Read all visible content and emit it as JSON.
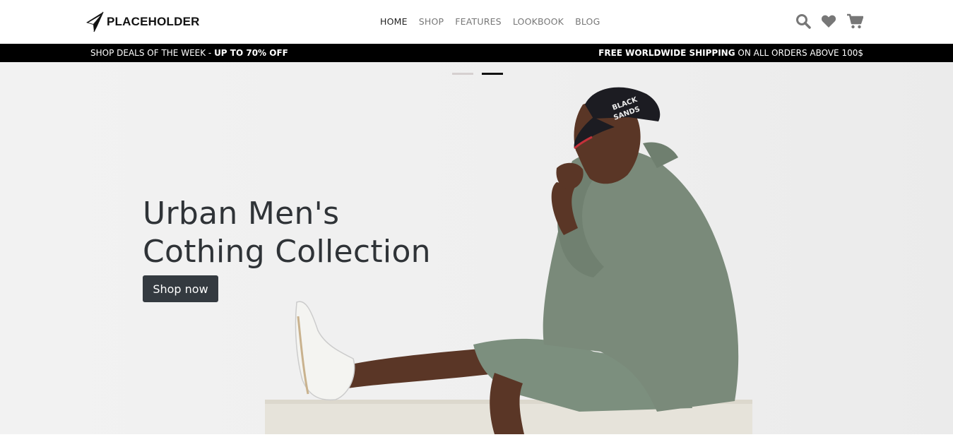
{
  "header": {
    "logo_text": "PLACEHOLDER",
    "logo_icon": "paper-plane-logo-icon",
    "nav": [
      {
        "label": "HOME",
        "active": true
      },
      {
        "label": "SHOP",
        "active": false
      },
      {
        "label": "FEATURES",
        "active": false
      },
      {
        "label": "LOOKBOOK",
        "active": false
      },
      {
        "label": "BLOG",
        "active": false
      }
    ],
    "icons": [
      "search-icon",
      "heart-icon",
      "cart-icon"
    ],
    "icon_color": "#777777"
  },
  "promo": {
    "left_prefix": "SHOP DEALS OF THE WEEK - ",
    "left_bold": "UP TO 70% OFF",
    "right_bold": "FREE WORLDWIDE SHIPPING",
    "right_suffix": " ON ALL ORDERS ABOVE 100$",
    "background": "#000000"
  },
  "hero": {
    "title_line1": "Urban Men's",
    "title_line2": "Cothing Collection",
    "button_label": "Shop now",
    "button_color": "#343a40",
    "cap_text_line1": "BLACK",
    "cap_text_line2": "SANDS",
    "slides": 2,
    "active_slide": 2
  }
}
